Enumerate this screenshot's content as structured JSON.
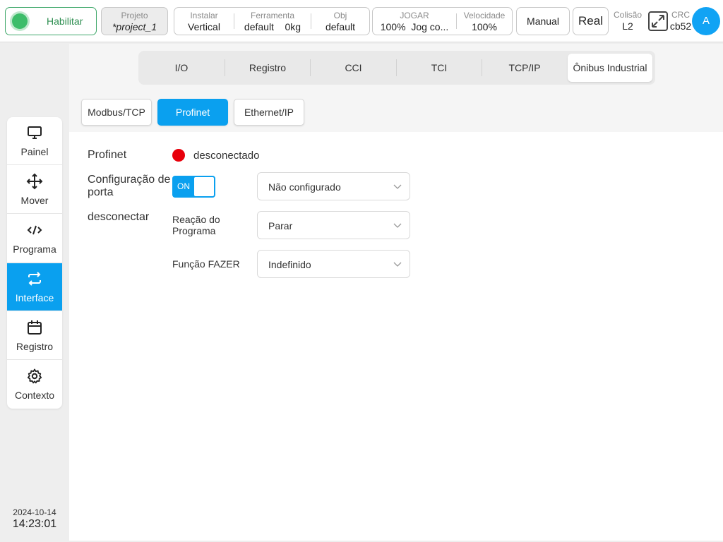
{
  "topbar": {
    "enable_label": "Habilitar",
    "project": {
      "label": "Projeto",
      "value": "*project_1"
    },
    "install": {
      "label": "Instalar",
      "value": "Vertical"
    },
    "tool": {
      "label": "Ferramenta",
      "value": "default",
      "load": "0kg"
    },
    "obj": {
      "label": "Obj",
      "value": "default"
    },
    "jog": {
      "label": "JOGAR",
      "value": "100%",
      "mode": "Jog co..."
    },
    "speed": {
      "label": "Velocidade",
      "value": "100%"
    },
    "manual_label": "Manual",
    "real_label": "Real",
    "collision": {
      "label": "Colisão",
      "value": "L2"
    },
    "crc": {
      "label": "CRC",
      "value": "cb52"
    },
    "avatar_letter": "A"
  },
  "sidebar": {
    "items": [
      {
        "label": "Painel",
        "icon": "monitor-icon"
      },
      {
        "label": "Mover",
        "icon": "move-arrows-icon"
      },
      {
        "label": "Programa",
        "icon": "code-icon"
      },
      {
        "label": "Interface",
        "icon": "swap-arrows-icon"
      },
      {
        "label": "Registro",
        "icon": "calendar-icon"
      },
      {
        "label": "Contexto",
        "icon": "gear-icon"
      }
    ],
    "active": "Interface",
    "date": "2024-10-14",
    "time": "14:23:01"
  },
  "tabs": {
    "items": [
      "I/O",
      "Registro",
      "CCI",
      "TCI",
      "TCP/IP",
      "Ônibus Industrial"
    ],
    "active": "Ônibus Industrial"
  },
  "subtabs": {
    "items": [
      "Modbus/TCP",
      "Profinet",
      "Ethernet/IP"
    ],
    "active": "Profinet"
  },
  "profinet": {
    "title": "Profinet",
    "status_text": "desconectado",
    "status_color": "#e8000b",
    "port_config_label": "Configuração de porta",
    "toggle_label": "ON",
    "port_select_value": "Não configurado",
    "disconnect_label": "desconectar",
    "program_reaction_label": "Reação do Programa",
    "program_reaction_value": "Parar",
    "do_function_label": "Função FAZER",
    "do_function_value": "Indefinido"
  },
  "colors": {
    "accent": "#0aa0ef",
    "enable_green": "#3dbd6a"
  }
}
